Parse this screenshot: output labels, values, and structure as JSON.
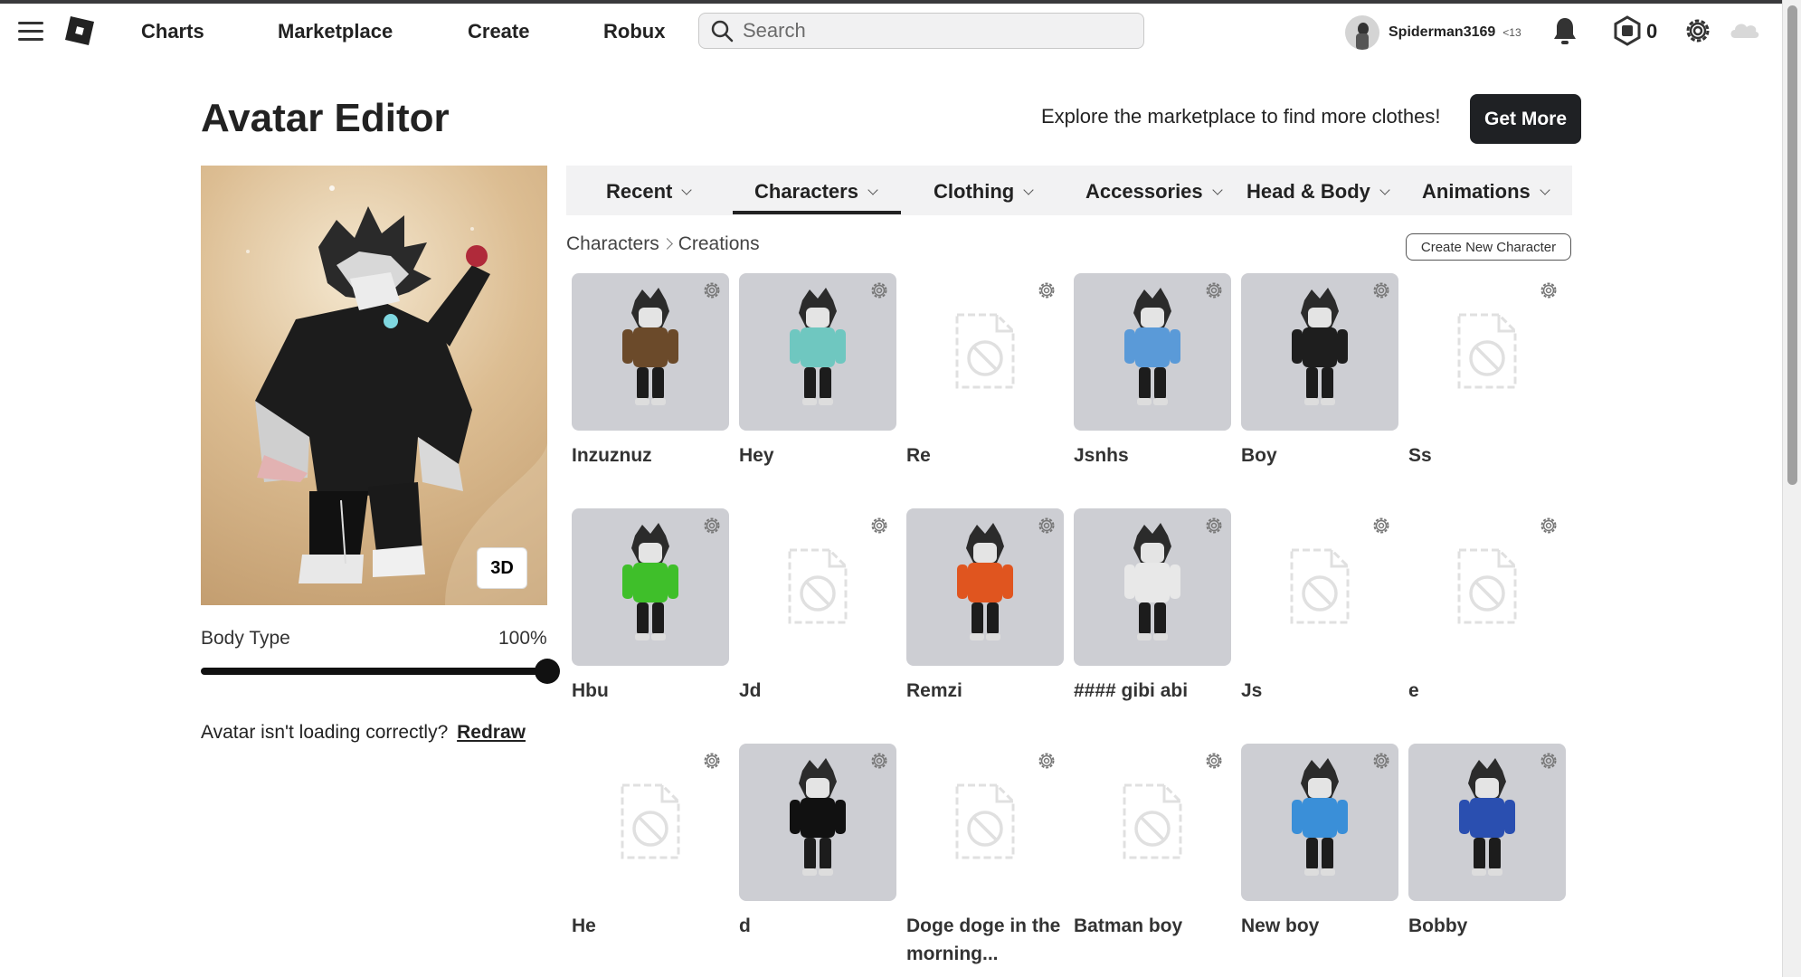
{
  "nav": {
    "links": [
      "Charts",
      "Marketplace",
      "Create",
      "Robux"
    ],
    "search_placeholder": "Search",
    "username": "Spiderman3169",
    "age_badge": "<13",
    "robux": "0"
  },
  "header": {
    "title": "Avatar Editor",
    "promo_text": "Explore the marketplace to find more clothes!",
    "get_more": "Get More"
  },
  "preview": {
    "mode_button": "3D",
    "body_type_label": "Body Type",
    "body_type_value": "100%",
    "body_type_fraction": 1.0,
    "help_text": "Avatar isn't loading correctly?",
    "redraw": "Redraw"
  },
  "tabs": {
    "items": [
      "Recent",
      "Characters",
      "Clothing",
      "Accessories",
      "Head & Body",
      "Animations"
    ],
    "active": "Characters"
  },
  "breadcrumb": {
    "root": "Characters",
    "current": "Creations"
  },
  "create_new": "Create New Character",
  "characters": [
    {
      "name": "Inzuznuz",
      "has_image": true,
      "outfit_color": "#6b4a2a"
    },
    {
      "name": "Hey",
      "has_image": true,
      "outfit_color": "#6fc7c0"
    },
    {
      "name": "Re",
      "has_image": false
    },
    {
      "name": "Jsnhs",
      "has_image": true,
      "outfit_color": "#5a9ad8"
    },
    {
      "name": "Boy",
      "has_image": true,
      "outfit_color": "#1e1e1e"
    },
    {
      "name": "Ss",
      "has_image": false
    },
    {
      "name": "Hbu",
      "has_image": true,
      "outfit_color": "#3fbf2a"
    },
    {
      "name": "Jd",
      "has_image": false
    },
    {
      "name": "Remzi",
      "has_image": true,
      "outfit_color": "#e0551f"
    },
    {
      "name": "#### gibi abi",
      "has_image": true,
      "outfit_color": "#e8e8e8"
    },
    {
      "name": "Js",
      "has_image": false
    },
    {
      "name": "e",
      "has_image": false
    },
    {
      "name": "He",
      "has_image": false
    },
    {
      "name": "d",
      "has_image": true,
      "outfit_color": "#111111"
    },
    {
      "name": "Doge doge in the morning...",
      "has_image": false
    },
    {
      "name": "Batman boy",
      "has_image": false
    },
    {
      "name": "New boy",
      "has_image": true,
      "outfit_color": "#3a8fd8"
    },
    {
      "name": "Bobby",
      "has_image": true,
      "outfit_color": "#2a4fb0"
    }
  ]
}
